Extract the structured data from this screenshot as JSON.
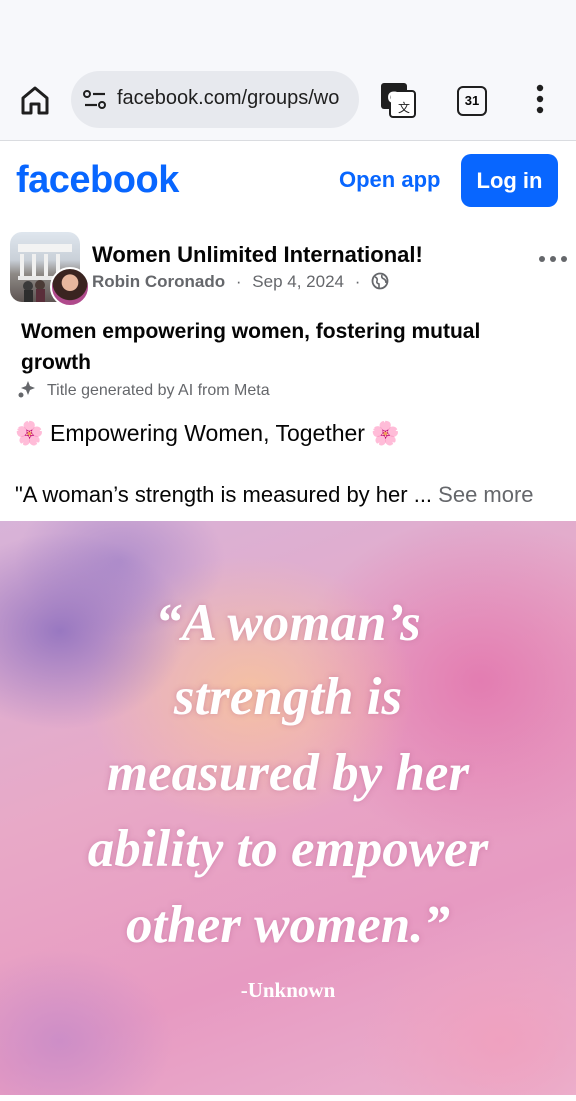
{
  "browser": {
    "url": "facebook.com/groups/wo",
    "tab_count": "31"
  },
  "header": {
    "logo": "facebook",
    "open_app": "Open app",
    "login": "Log in",
    "brand_color": "#0866ff"
  },
  "post": {
    "group_name": "Women Unlimited International!",
    "author": "Robin Coronado",
    "date": "Sep 4, 2024",
    "separator": "·",
    "title": "Women empowering women, fostering mutual growth",
    "ai_note": "Title generated by AI from Meta",
    "heading_emoji": "🌸",
    "heading_text": "Empowering Women, Together",
    "body_text": "\"A woman’s strength is measured by her ... ",
    "see_more": "See more"
  },
  "image": {
    "quote_lines": [
      "“A woman’s",
      "strength is",
      "measured by her",
      "ability to empower",
      "other women.”"
    ],
    "attribution": "-Unknown"
  }
}
